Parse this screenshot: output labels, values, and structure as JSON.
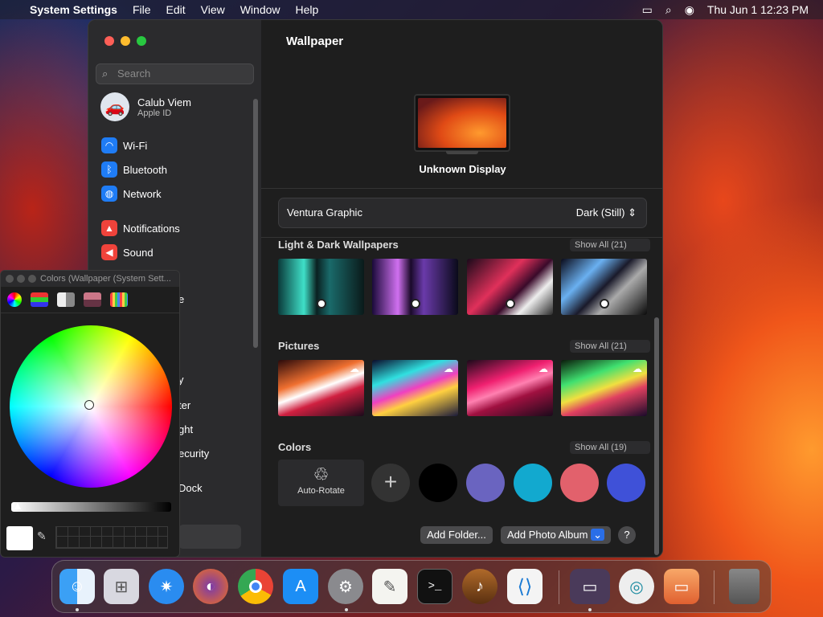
{
  "menubar": {
    "app": "System Settings",
    "menus": [
      "File",
      "Edit",
      "View",
      "Window",
      "Help"
    ],
    "clock": "Thu Jun 1  12:23 PM"
  },
  "sidebar": {
    "search_placeholder": "Search",
    "user": {
      "name": "Calub Viem",
      "sub": "Apple ID"
    },
    "items": [
      {
        "label": "Wi-Fi",
        "color": "#1f7cf5",
        "icon": "wifi-icon"
      },
      {
        "label": "Bluetooth",
        "color": "#1f7cf5",
        "icon": "bluetooth-icon"
      },
      {
        "label": "Network",
        "color": "#1f7cf5",
        "icon": "globe-icon"
      },
      {
        "label": "Notifications",
        "color": "#f0433b",
        "icon": "bell-icon"
      },
      {
        "label": "Sound",
        "color": "#f0433b",
        "icon": "speaker-icon"
      }
    ],
    "partial": [
      "e",
      "y",
      "ter",
      "ght",
      "ecurity",
      "Dock"
    ]
  },
  "main": {
    "title": "Wallpaper",
    "display": "Unknown Display",
    "wallpaper_name": "Ventura Graphic",
    "wallpaper_mode": "Dark (Still)",
    "sections": [
      {
        "title": "Light & Dark Wallpapers",
        "show_all": "Show All (21)"
      },
      {
        "title": "Pictures",
        "show_all": "Show All (21)"
      },
      {
        "title": "Colors",
        "show_all": "Show All (19)"
      }
    ],
    "auto_rotate": "Auto-Rotate",
    "colors": [
      "#000000",
      "#6a64c0",
      "#12a9cf",
      "#e2616c",
      "#3f51d8"
    ],
    "add_folder": "Add Folder...",
    "add_album": "Add Photo Album",
    "help": "?"
  },
  "colors_panel": {
    "title": "Colors (Wallpaper (System Sett..."
  }
}
